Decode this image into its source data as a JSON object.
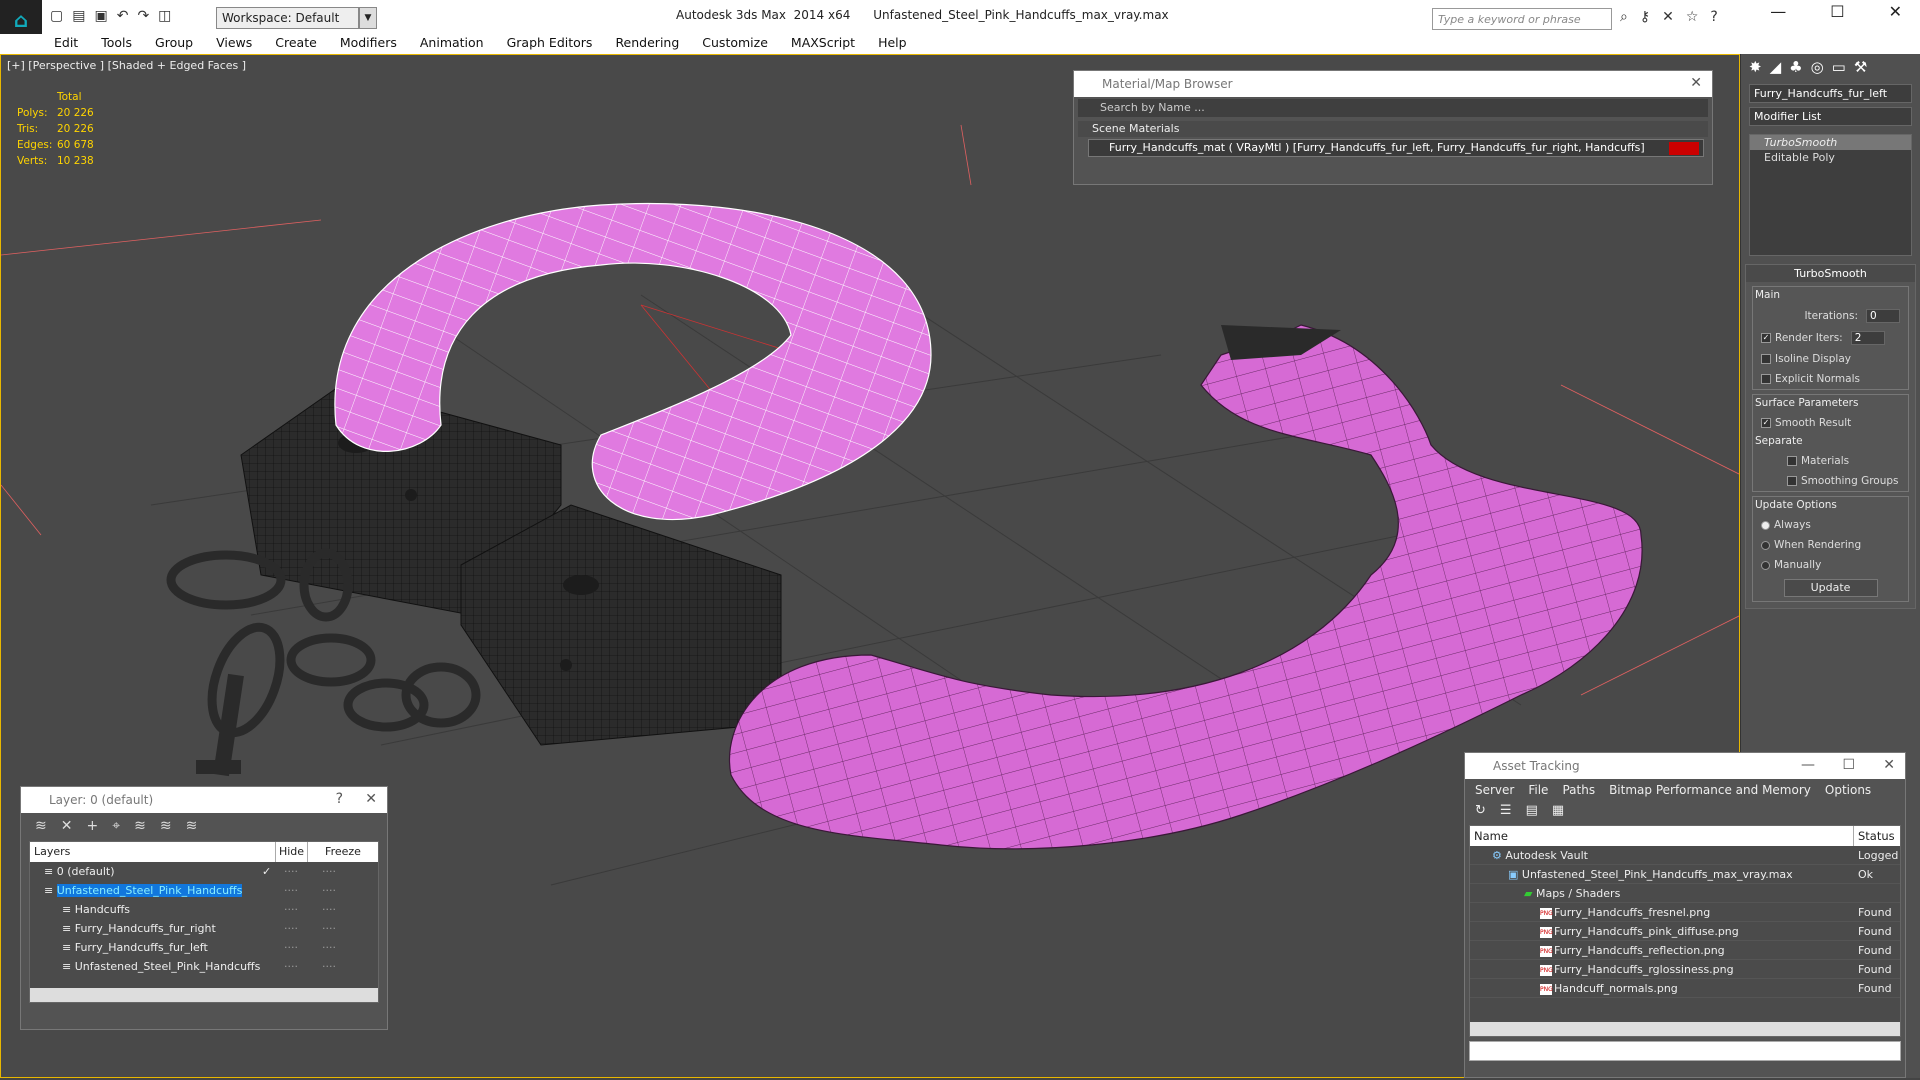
{
  "titlebar": {
    "workspace": "Workspace: Default",
    "title": "Autodesk 3ds Max  2014 x64      Unfastened_Steel_Pink_Handcuffs_max_vray.max",
    "search_placeholder": "Type a keyword or phrase"
  },
  "menu": [
    "Edit",
    "Tools",
    "Group",
    "Views",
    "Create",
    "Modifiers",
    "Animation",
    "Graph Editors",
    "Rendering",
    "Customize",
    "MAXScript",
    "Help"
  ],
  "viewport": {
    "label": "[+] [Perspective ] [Shaded + Edged Faces ]",
    "stats_header": "Total",
    "stats": [
      {
        "k": "Polys:",
        "v": "20 226"
      },
      {
        "k": "Tris:",
        "v": "20 226"
      },
      {
        "k": "Edges:",
        "v": "60 678"
      },
      {
        "k": "Verts:",
        "v": "10 238"
      }
    ]
  },
  "material_browser": {
    "title": "Material/Map Browser",
    "search": "Search by Name ...",
    "section": "Scene Materials",
    "row": "Furry_Handcuffs_mat  ( VRayMtl ) [Furry_Handcuffs_fur_left, Furry_Handcuffs_fur_right, Handcuffs]"
  },
  "command_panel": {
    "object_name": "Furry_Handcuffs_fur_left",
    "modifier_list": "Modifier List",
    "stack": [
      "TurboSmooth",
      "Editable Poly"
    ],
    "rollout_title": "TurboSmooth",
    "main_label": "Main",
    "iterations_label": "Iterations:",
    "iterations": "0",
    "render_iters_label": "Render Iters:",
    "render_iters": "2",
    "isoline": "Isoline Display",
    "explicit_normals": "Explicit Normals",
    "surface_params": "Surface Parameters",
    "smooth_result": "Smooth Result",
    "separate": "Separate",
    "materials": "Materials",
    "smoothing_groups": "Smoothing Groups",
    "update_options": "Update Options",
    "always": "Always",
    "when_rendering": "When Rendering",
    "manually": "Manually",
    "update": "Update"
  },
  "layer_window": {
    "title": "Layer: 0 (default)",
    "help": "?",
    "col_layers": "Layers",
    "col_hide": "Hide",
    "col_freeze": "Freeze",
    "rows": [
      {
        "name": "0 (default)",
        "indent": 14
      },
      {
        "name": "Unfastened_Steel_Pink_Handcuffs",
        "indent": 14
      },
      {
        "name": "Handcuffs",
        "indent": 32
      },
      {
        "name": "Furry_Handcuffs_fur_right",
        "indent": 32
      },
      {
        "name": "Furry_Handcuffs_fur_left",
        "indent": 32
      },
      {
        "name": "Unfastened_Steel_Pink_Handcuffs",
        "indent": 32
      }
    ]
  },
  "asset_tracking": {
    "title": "Asset Tracking",
    "menu": [
      "Server",
      "File",
      "Paths",
      "Bitmap Performance and Memory",
      "Options"
    ],
    "col_name": "Name",
    "col_status": "Status",
    "rows": [
      {
        "name": "Autodesk Vault",
        "status": "Logged",
        "indent": 22,
        "icon": "vault"
      },
      {
        "name": "Unfastened_Steel_Pink_Handcuffs_max_vray.max",
        "status": "Ok",
        "indent": 38,
        "icon": "max"
      },
      {
        "name": "Maps / Shaders",
        "status": "",
        "indent": 54,
        "icon": "maps"
      },
      {
        "name": "Furry_Handcuffs_fresnel.png",
        "status": "Found",
        "indent": 70,
        "icon": "png"
      },
      {
        "name": "Furry_Handcuffs_pink_diffuse.png",
        "status": "Found",
        "indent": 70,
        "icon": "png"
      },
      {
        "name": "Furry_Handcuffs_reflection.png",
        "status": "Found",
        "indent": 70,
        "icon": "png"
      },
      {
        "name": "Furry_Handcuffs_rglossiness.png",
        "status": "Found",
        "indent": 70,
        "icon": "png"
      },
      {
        "name": "Handcuff_normals.png",
        "status": "Found",
        "indent": 70,
        "icon": "png"
      }
    ]
  },
  "colors": {
    "pink": "#d66ad4",
    "accent": "#e8b700",
    "selection": "#1177dd"
  }
}
